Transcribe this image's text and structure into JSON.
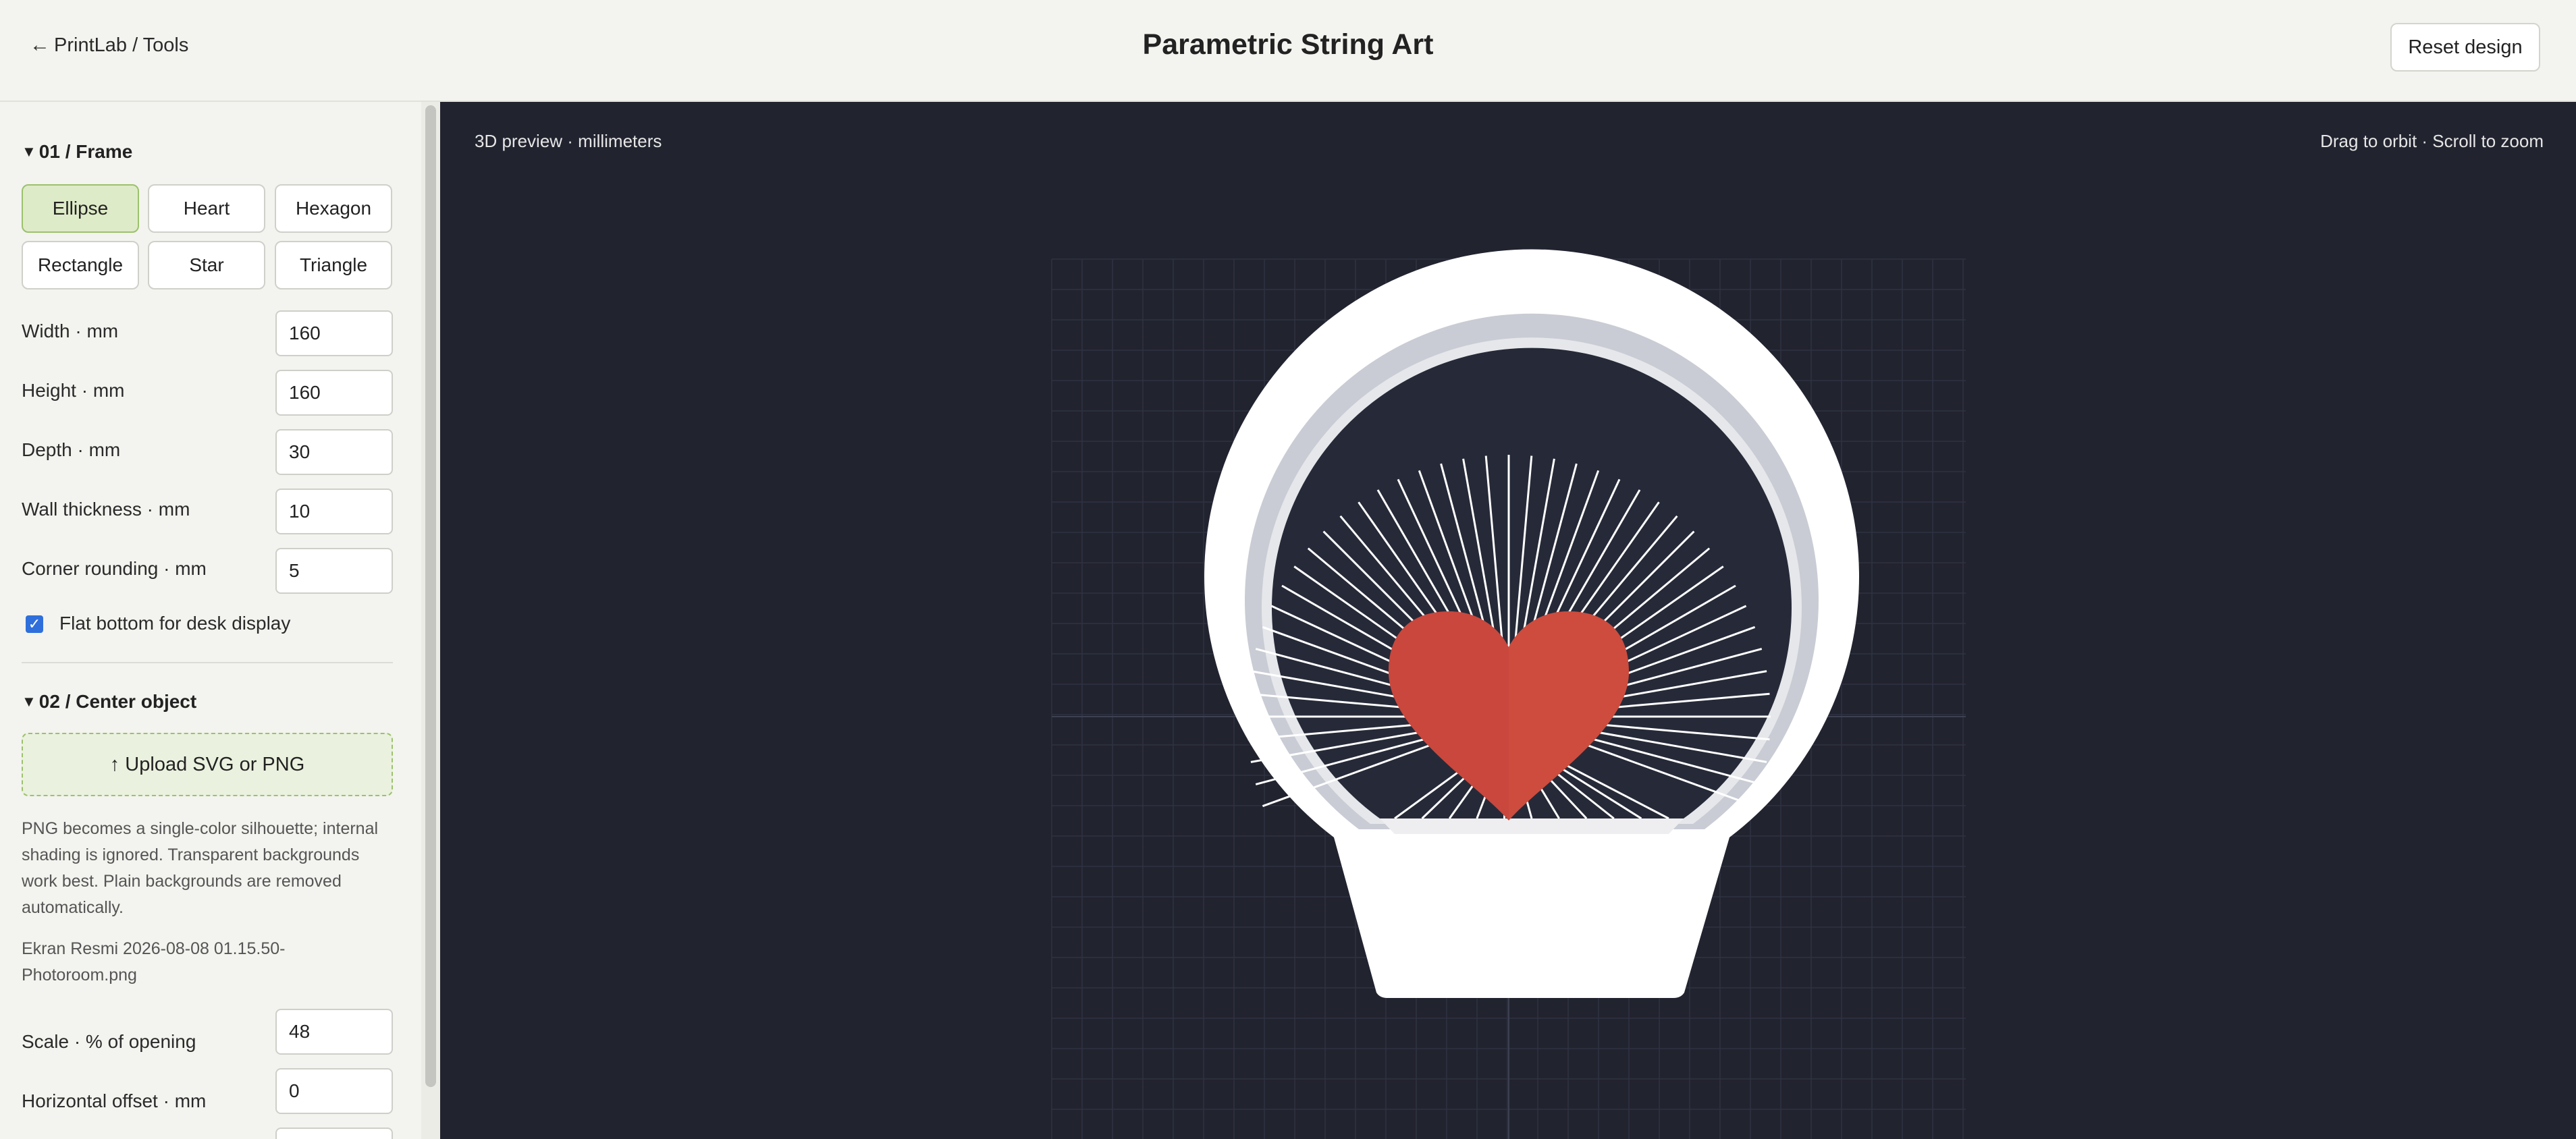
{
  "header": {
    "back_link": "PrintLab / Tools",
    "title": "Parametric String Art",
    "reset_label": "Reset design"
  },
  "sidebar": {
    "frame_section": {
      "title": "01 / Frame",
      "shapes": [
        "Ellipse",
        "Heart",
        "Hexagon",
        "Rectangle",
        "Star",
        "Triangle"
      ],
      "selected_shape": "Ellipse",
      "fields": [
        {
          "label": "Width · mm",
          "value": "160"
        },
        {
          "label": "Height · mm",
          "value": "160"
        },
        {
          "label": "Depth · mm",
          "value": "30"
        },
        {
          "label": "Wall thickness · mm",
          "value": "10"
        },
        {
          "label": "Corner rounding · mm",
          "value": "5"
        }
      ],
      "flat_bottom_label": "Flat bottom for desk display",
      "flat_bottom_checked": true
    },
    "center_section": {
      "title": "02 / Center object",
      "upload_label": "↑ Upload SVG or PNG",
      "help_text": "PNG becomes a single-color silhouette; internal shading is ignored. Transparent backgrounds work best. Plain backgrounds are removed automatically.",
      "file_name": "Ekran Resmi 2026-08-08 01.15.50-Photoroom.png",
      "fields": [
        {
          "label": "Scale · % of opening",
          "value": "48"
        },
        {
          "label": "Horizontal offset · mm",
          "value": "0"
        },
        {
          "label": "",
          "value": ""
        }
      ]
    }
  },
  "viewport": {
    "left_label": "3D preview · millimeters",
    "right_label": "Drag to orbit · Scroll to zoom",
    "colors": {
      "background": "#21232f",
      "frame": "#ffffff",
      "heart": "#c9473d",
      "strings": "#ffffff"
    }
  }
}
